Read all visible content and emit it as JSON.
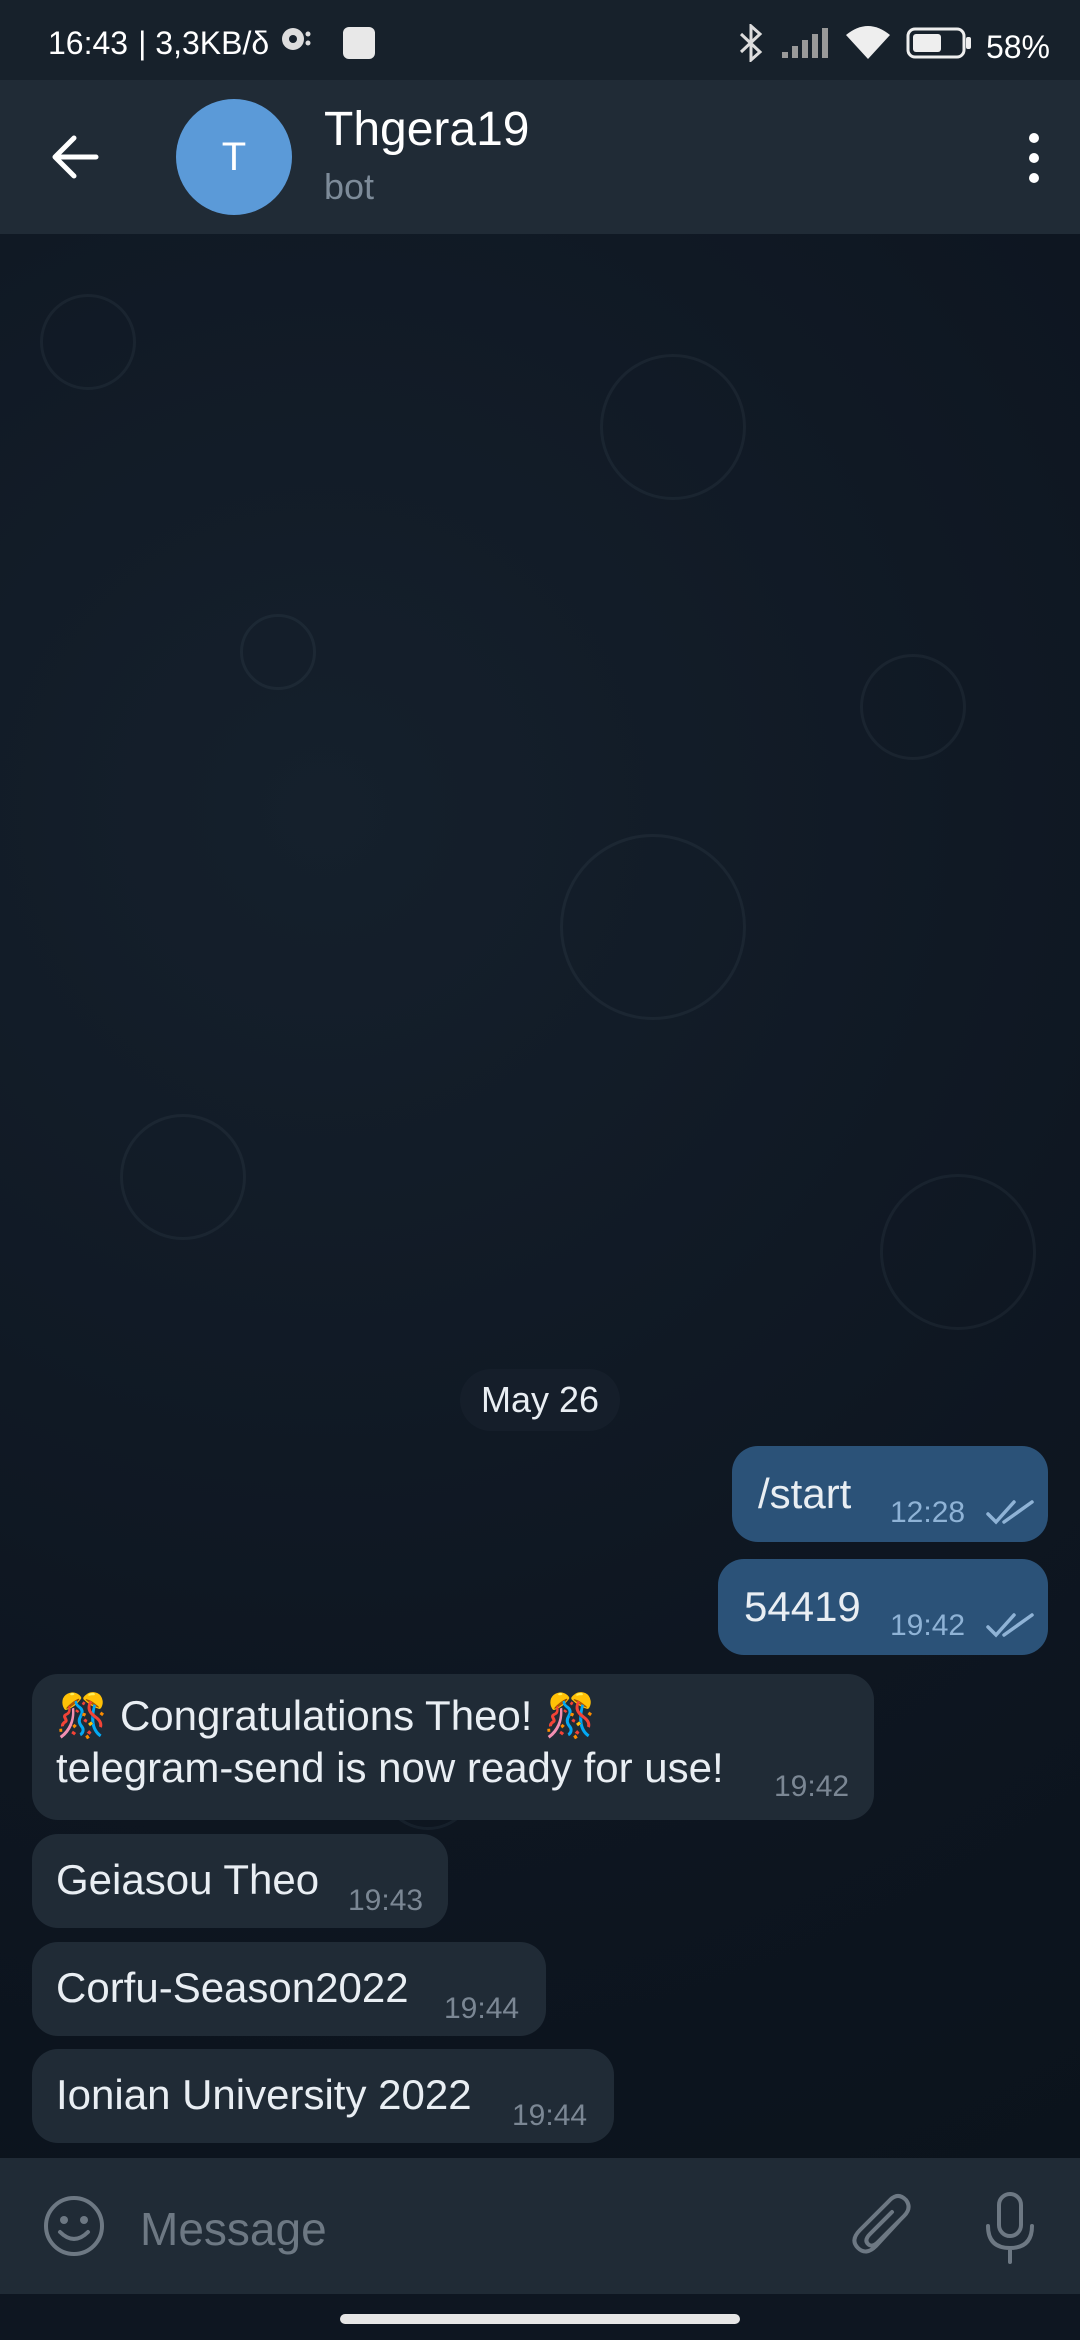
{
  "status_bar": {
    "time": "16:43",
    "network": "| 3,3KB/δ",
    "battery": "58%"
  },
  "header": {
    "avatar_initial": "T",
    "title": "Thgera19",
    "subtitle": "bot"
  },
  "chat": {
    "date_label": "May 26",
    "messages": [
      {
        "direction": "out",
        "text": "/start",
        "time": "12:28",
        "read": true
      },
      {
        "direction": "out",
        "text": "54419",
        "time": "19:42",
        "read": true
      },
      {
        "direction": "in",
        "line1": "🎊 Congratulations Theo! 🎊",
        "line2": "telegram-send is now ready for use!",
        "time": "19:42"
      },
      {
        "direction": "in",
        "text": "Geiasou Theo",
        "time": "19:43"
      },
      {
        "direction": "in",
        "text": "Corfu-Season2022",
        "time": "19:44"
      },
      {
        "direction": "in",
        "text": "Ionian University 2022",
        "time": "19:44"
      }
    ]
  },
  "composer": {
    "placeholder": "Message"
  },
  "colors": {
    "outgoing_bubble": "#2b5278",
    "incoming_bubble": "#202b36",
    "avatar": "#5b9ad8"
  }
}
